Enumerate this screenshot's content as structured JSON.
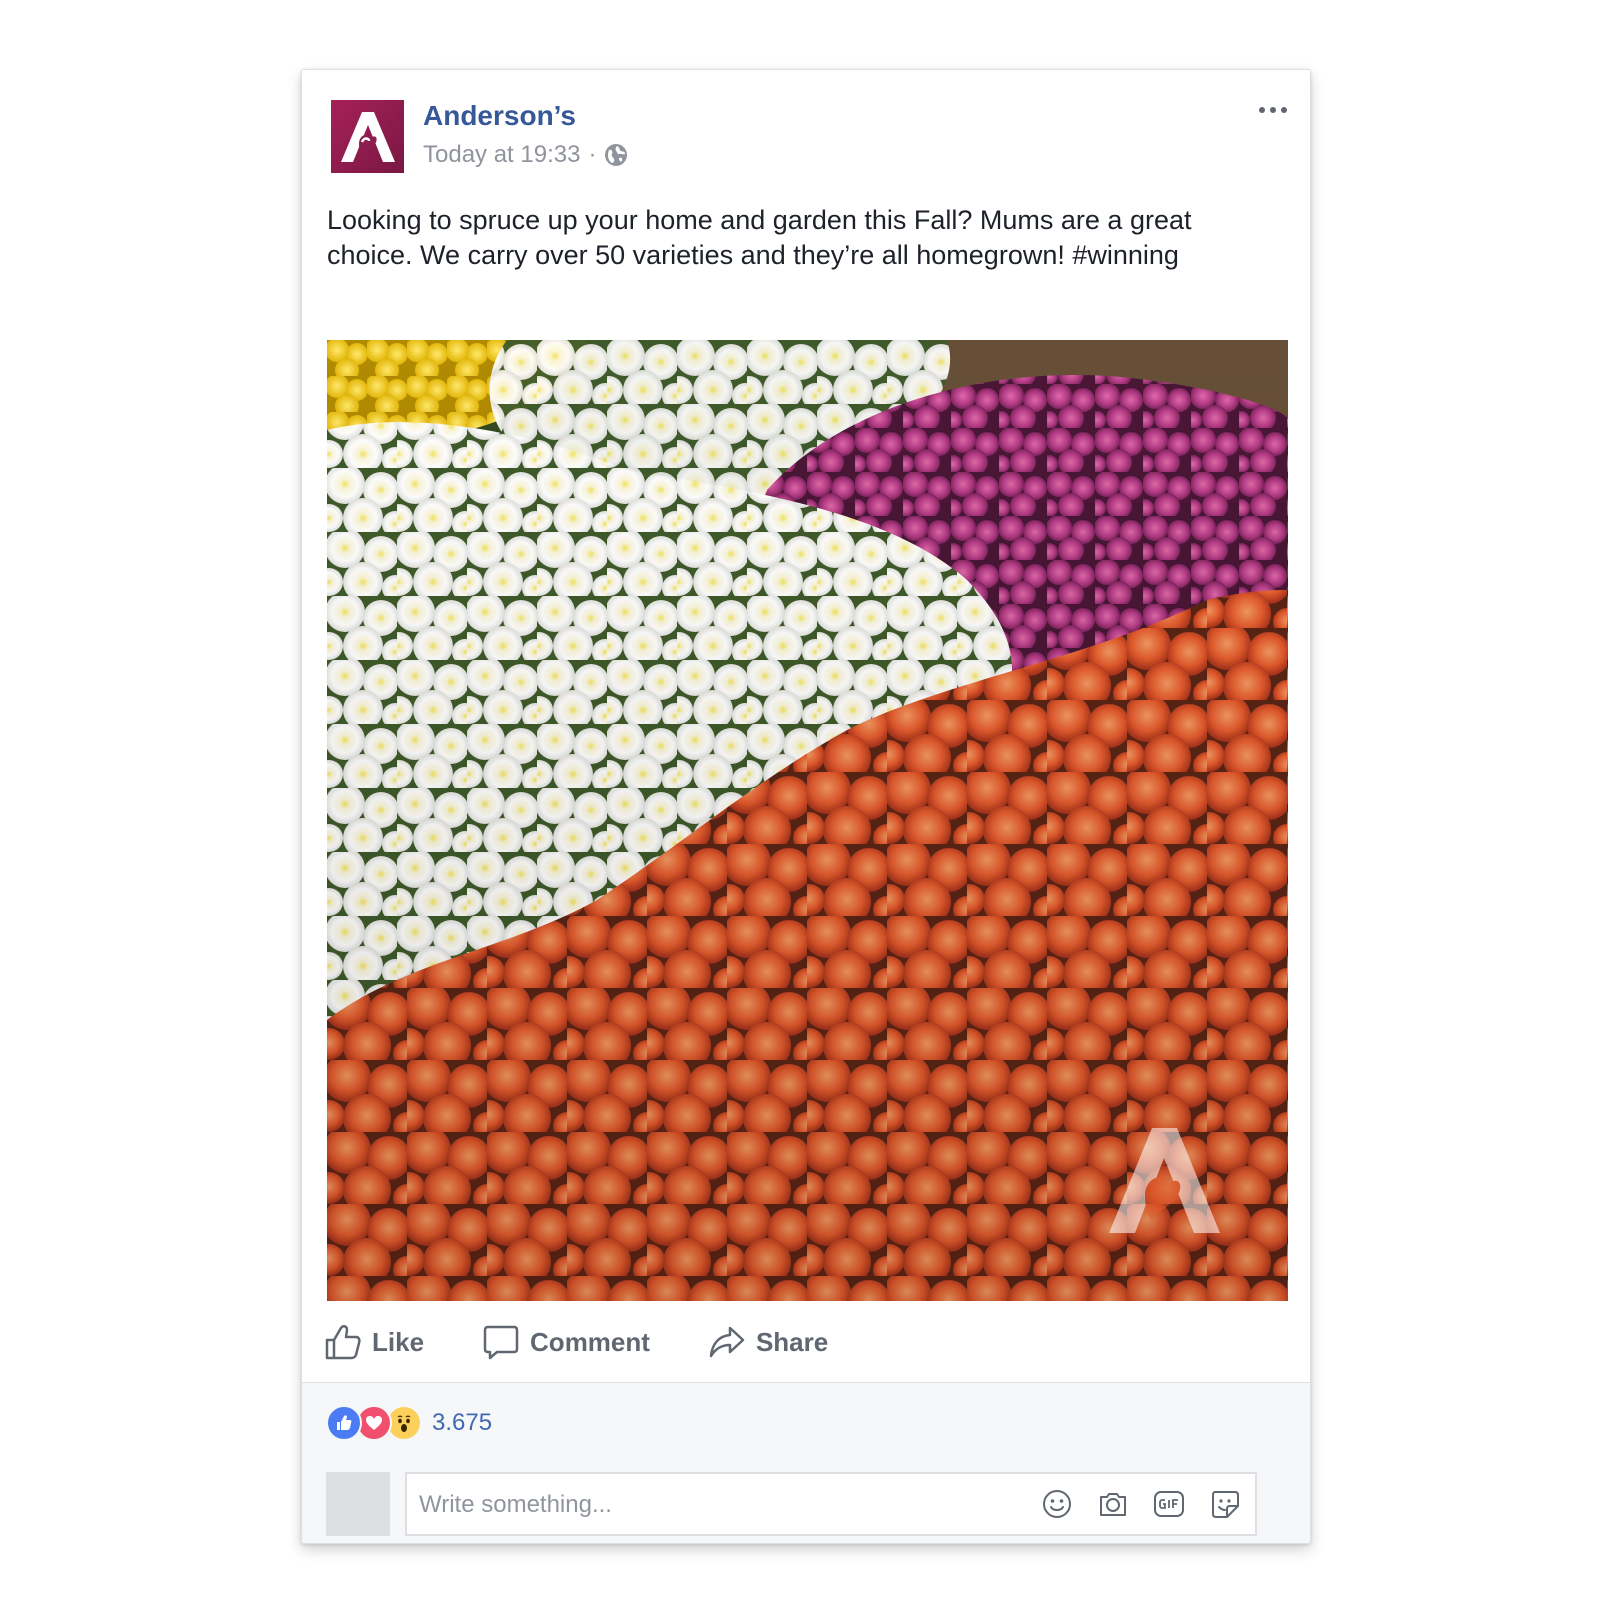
{
  "post": {
    "page_name": "Anderson’s",
    "timestamp": "Today at 19:33",
    "separator": "·",
    "audience_icon": "globe-icon",
    "menu_icon": "more-options-icon",
    "text": "Looking to spruce up your home and garden this Fall? Mums are a great choice. We carry over 50 varieties and they’re all homegrown! #winning",
    "photo": {
      "subject": "photo",
      "watermark_logo_text": "A"
    },
    "logo_text": "A",
    "brand_color": "#8b1e4f"
  },
  "actions": {
    "like_label": "Like",
    "like_icon": "thumbs-up-icon",
    "comment_label": "Comment",
    "comment_icon": "speech-bubble-icon",
    "share_label": "Share",
    "share_icon": "share-arrow-icon"
  },
  "reactions": {
    "icons": [
      "like-reaction-icon",
      "love-reaction-icon",
      "wow-reaction-icon"
    ],
    "colors": {
      "like": "#4b7cf3",
      "love": "#f0506e",
      "wow": "#fcd15b"
    },
    "count": "3.675"
  },
  "comment": {
    "placeholder": "Write something...",
    "icons": [
      "emoji-icon",
      "camera-icon",
      "gif-icon",
      "sticker-icon"
    ]
  }
}
